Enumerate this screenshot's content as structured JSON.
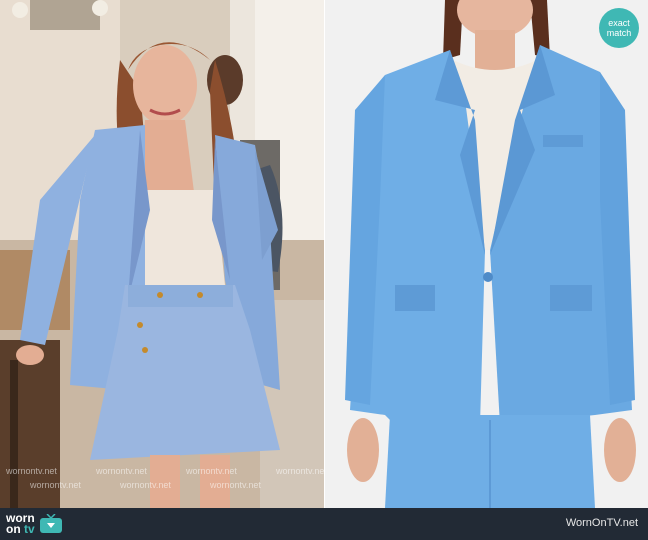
{
  "badge": {
    "line1": "exact",
    "line2": "match"
  },
  "watermark": {
    "text": "wornontv.net"
  },
  "footer": {
    "logo": {
      "line1": "worn",
      "line2_prefix": "on ",
      "line2_accent": "tv"
    },
    "site": "WornOnTV.net"
  },
  "colors": {
    "blazer_blue": "#8fb1e0",
    "product_blue": "#6faee6",
    "badge_teal": "#3fb8b4",
    "footer_bg": "#222a35"
  }
}
